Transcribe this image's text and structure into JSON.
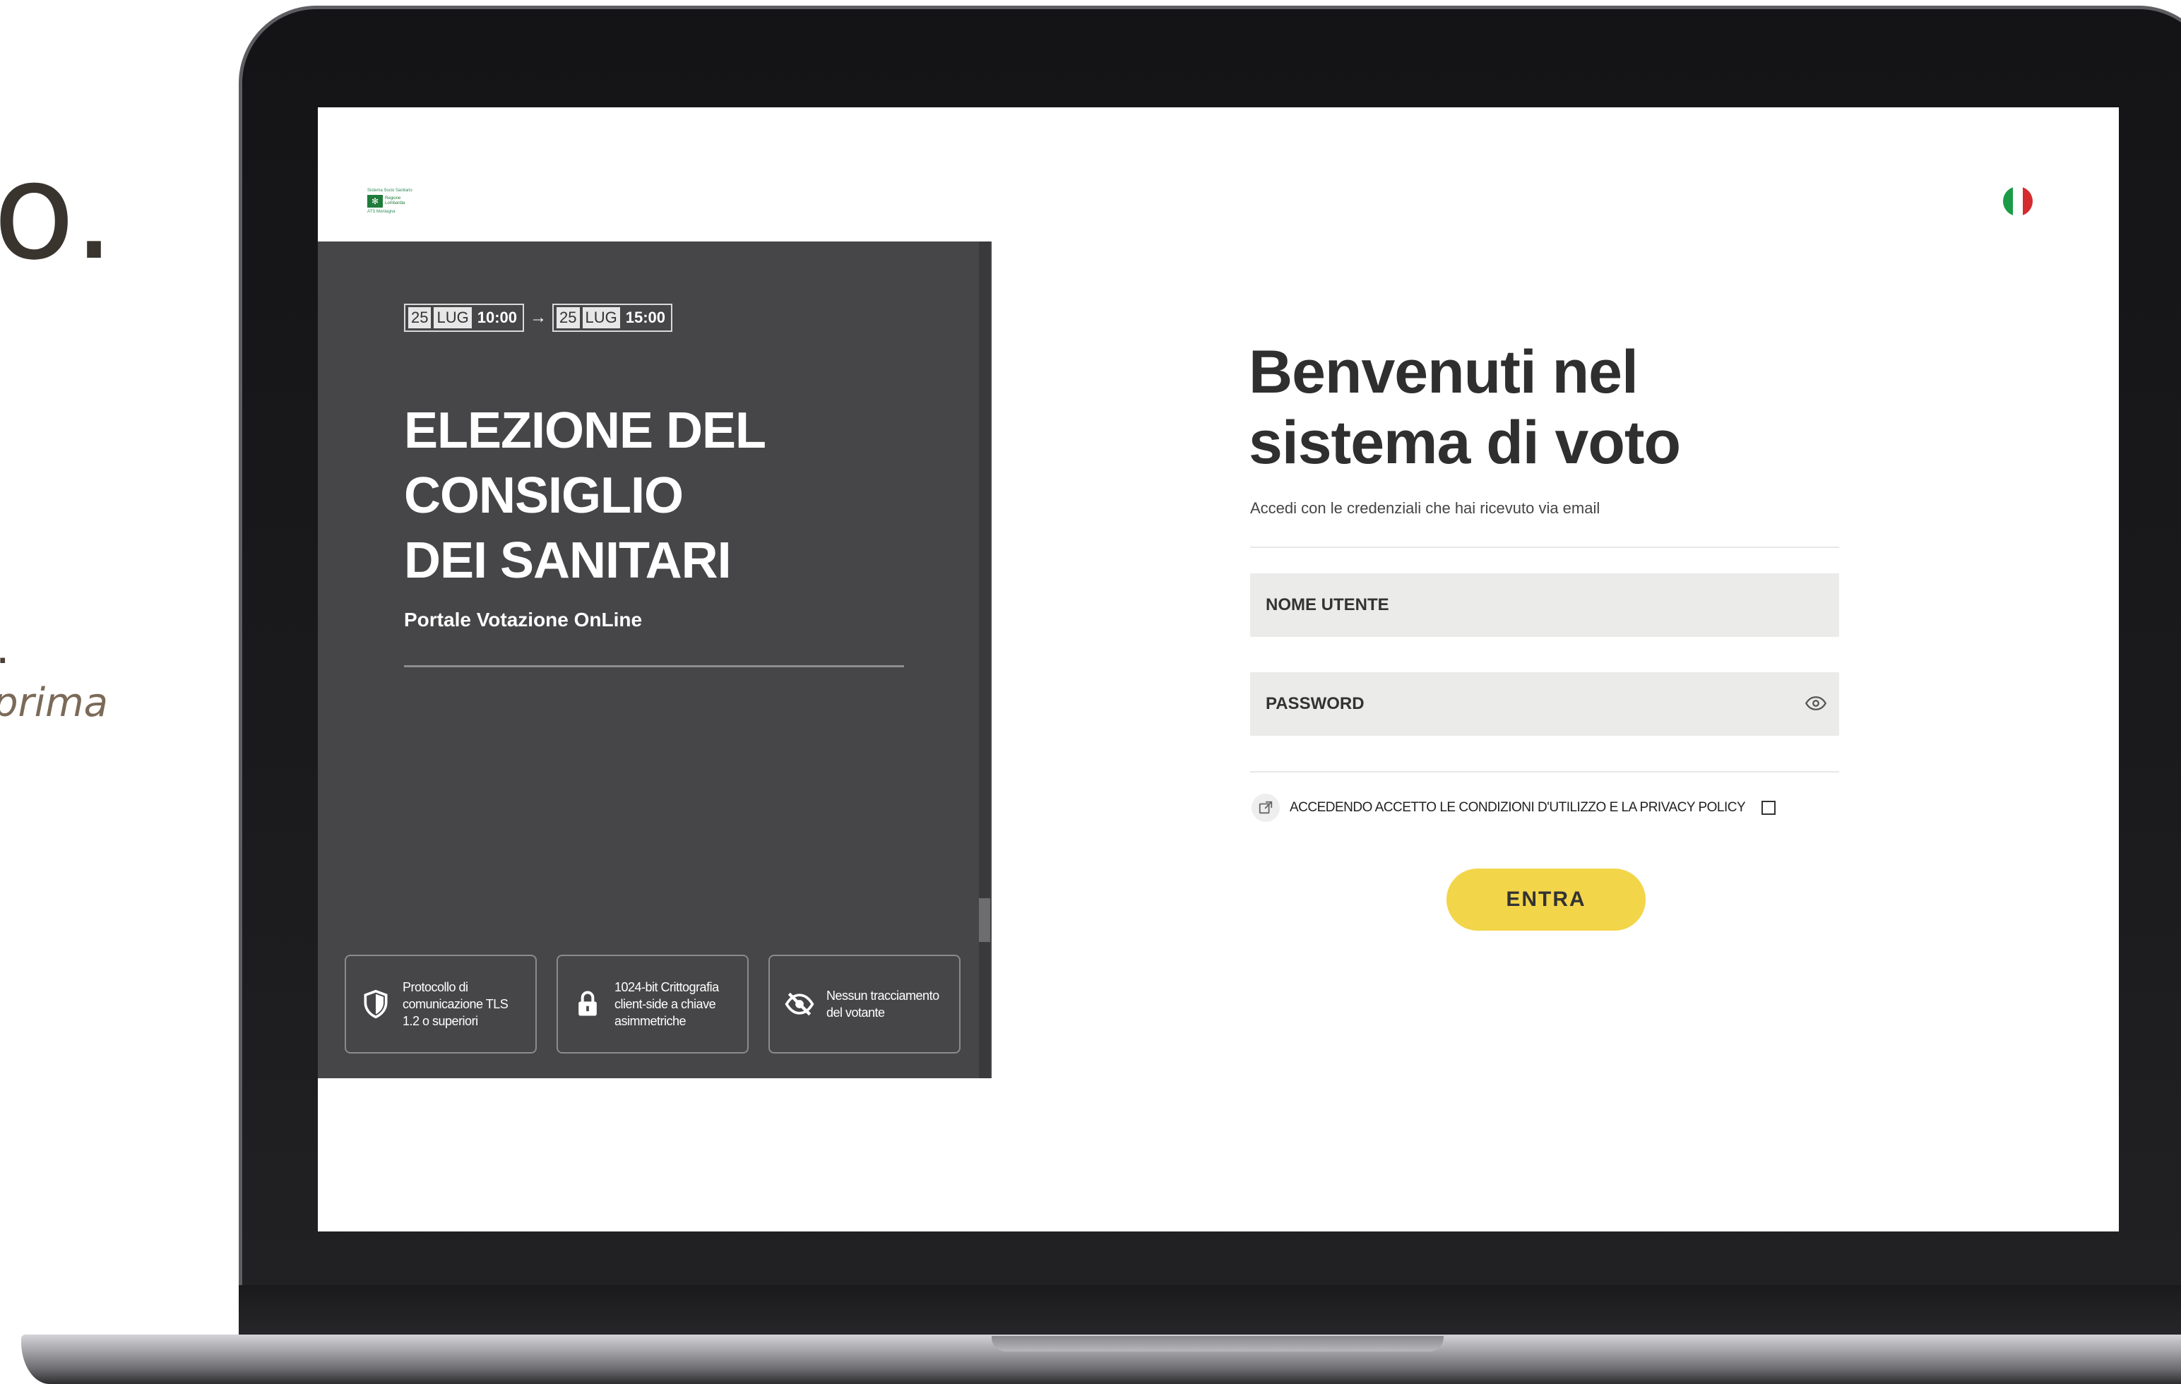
{
  "background_text": {
    "fragment_big": "o.",
    "fragment_dot": ".",
    "fragment_italic": "prima"
  },
  "header": {
    "logo": {
      "line1": "Sistema Socio Sanitario",
      "name1": "Regione",
      "name2": "Lombardia",
      "line2": "ATS Montagna"
    },
    "language_flag": "flag-italy-icon"
  },
  "election": {
    "start": {
      "day": "25",
      "month": "LUG",
      "time": "10:00"
    },
    "arrow": "→",
    "end": {
      "day": "25",
      "month": "LUG",
      "time": "15:00"
    },
    "title_line1": "ELEZIONE DEL",
    "title_line2": "CONSIGLIO",
    "title_line3": "DEI SANITARI",
    "subtitle": "Portale Votazione OnLine"
  },
  "features": [
    {
      "icon": "shield-icon",
      "text": "Protocollo di comunicazione TLS 1.2 o superiori"
    },
    {
      "icon": "lock-icon",
      "text": "1024-bit Crittografia client-side a chiave asimmetriche"
    },
    {
      "icon": "eye-off-icon",
      "text": "Nessun tracciamento del votante"
    }
  ],
  "login": {
    "heading_line1": "Benvenuti nel",
    "heading_line2": "sistema di voto",
    "hint": "Accedi con le credenziali che hai ricevuto via email",
    "username_placeholder": "NOME UTENTE",
    "password_placeholder": "PASSWORD",
    "policy_text": "ACCEDENDO ACCETTO LE CONDIZIONI D'UTILIZZO E LA PRIVACY POLICY",
    "submit_label": "ENTRA"
  },
  "colors": {
    "panel": "#464547",
    "accent_button": "#f3d54a",
    "field_bg": "#ebebea"
  }
}
